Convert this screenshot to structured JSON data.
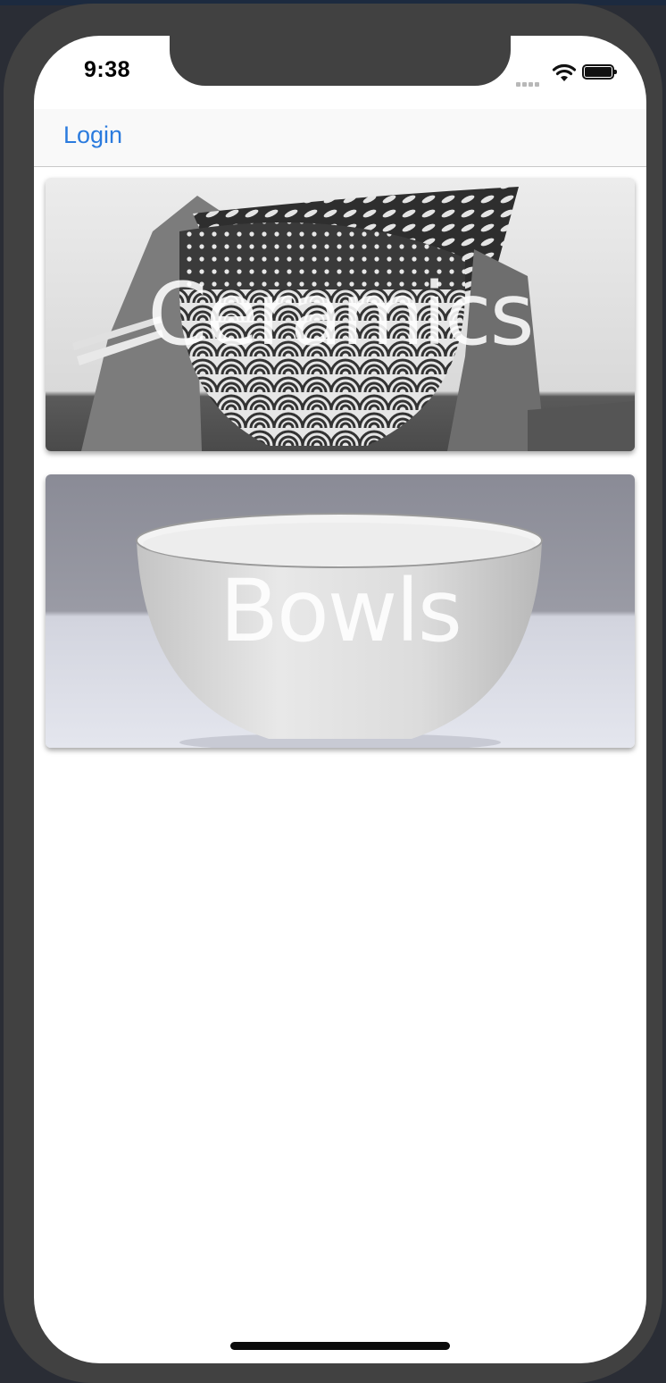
{
  "status_bar": {
    "time": "9:38"
  },
  "nav": {
    "login_label": "Login"
  },
  "categories": [
    {
      "title": "Ceramics"
    },
    {
      "title": "Bowls"
    }
  ],
  "colors": {
    "accent": "#2b7bde",
    "frame": "#414141"
  },
  "icons": [
    "signal-icon",
    "wifi-icon",
    "battery-icon"
  ]
}
